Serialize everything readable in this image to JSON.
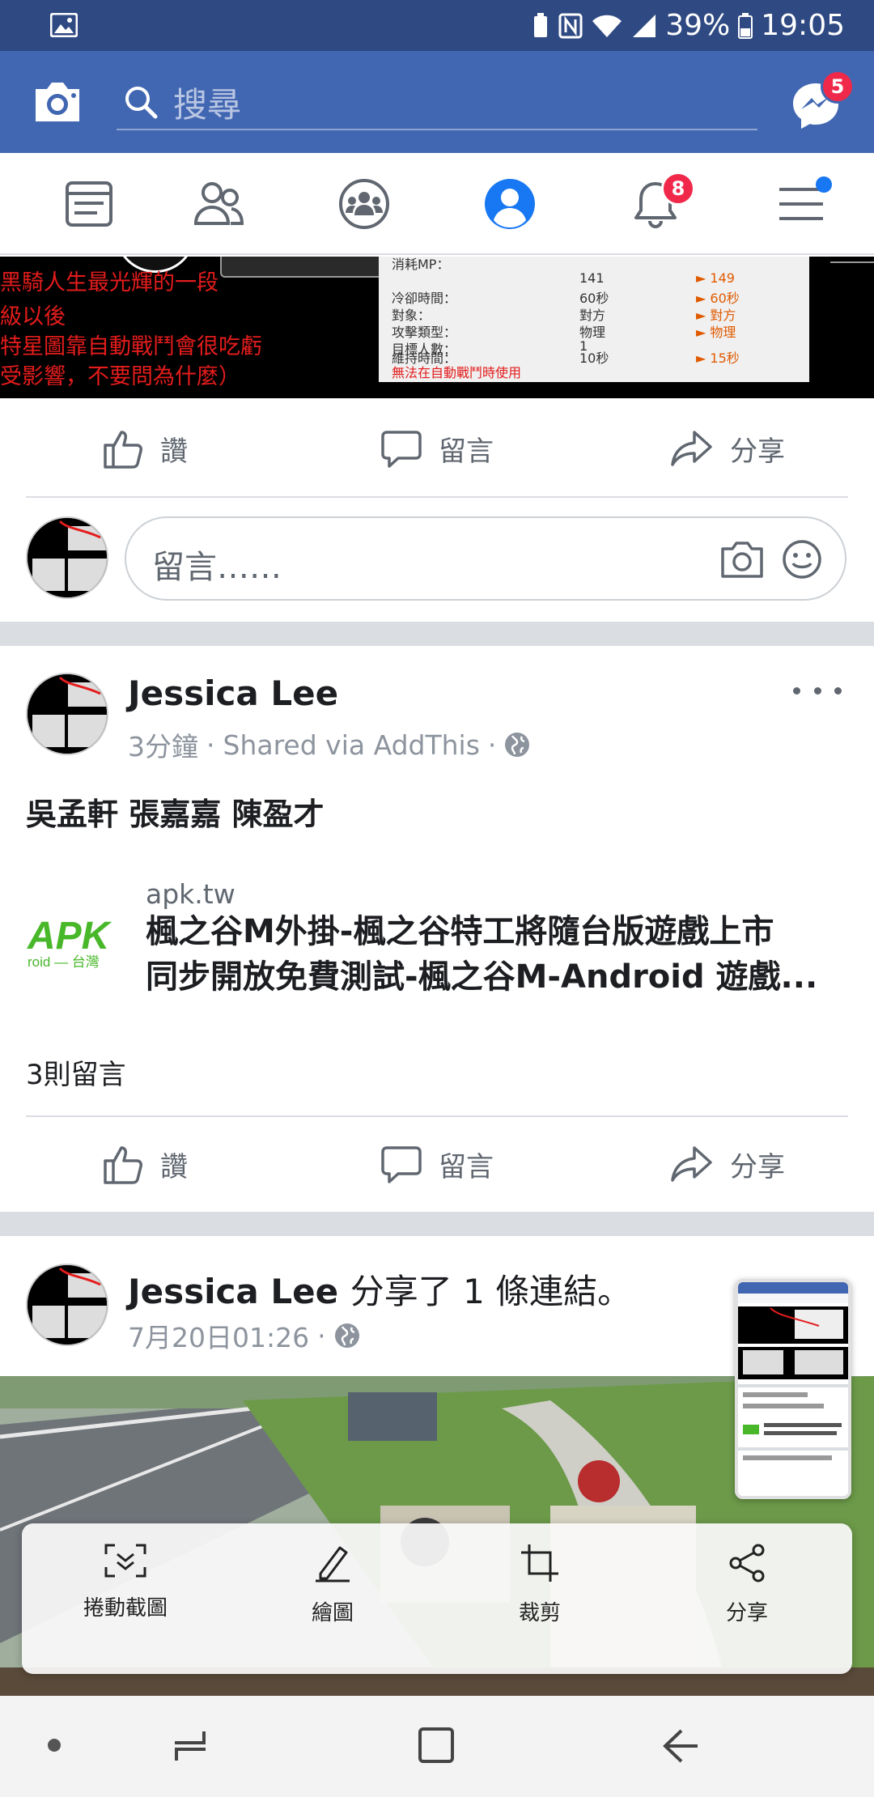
{
  "status_bar": {
    "battery": "39%",
    "time": "19:05"
  },
  "header": {
    "search_placeholder": "搜尋",
    "messenger_badge": "5"
  },
  "nav": {
    "notifications_badge": "8"
  },
  "partial_post": {
    "image_lines": [
      "黑騎人生最光輝的一段",
      "級以後",
      "特星圖靠自動戰鬥會很吃虧",
      "受影響，不要問為什麼）"
    ],
    "table_rows": [
      {
        "k": "消耗MP：",
        "v": "",
        "n": ""
      },
      {
        "k": "",
        "v": "141",
        "n": "► 149"
      },
      {
        "k": "冷卻時間：",
        "v": "60秒",
        "n": "► 60秒"
      },
      {
        "k": "對象：",
        "v": "對方",
        "n": "► 對方"
      },
      {
        "k": "攻擊類型：",
        "v": "物理",
        "n": "► 物理"
      },
      {
        "k": "目標人數：",
        "v": "1",
        "n": ""
      },
      {
        "k": "維持時間：",
        "v": "10秒",
        "n": "► 15秒"
      }
    ],
    "table_warning": "無法在自動戰鬥時使用",
    "like": "讚",
    "comment": "留言",
    "share": "分享"
  },
  "comment_box": {
    "placeholder": "留言……"
  },
  "post1": {
    "author": "Jessica Lee",
    "time": "3分鐘",
    "via": "Shared via AddThis",
    "text": "吳孟軒 張嘉嘉 陳盈才",
    "link": {
      "domain": "apk.tw",
      "title_line1": "楓之谷M外掛-楓之谷特工將隨台版遊戲上市",
      "title_line2": "同步開放免費測試-楓之谷M-Android 遊戲...",
      "thumb_text": "APK",
      "thumb_sub": "roid — 台灣"
    },
    "comment_count": "3則留言",
    "like": "讚",
    "comment": "留言",
    "share": "分享"
  },
  "post2": {
    "author": "Jessica Lee",
    "action": "分享了 1 條連結。",
    "time": "7月20日01:26"
  },
  "screenshot_toolbar": {
    "scroll_capture": "捲動截圖",
    "draw": "繪圖",
    "crop": "裁剪",
    "share": "分享"
  }
}
